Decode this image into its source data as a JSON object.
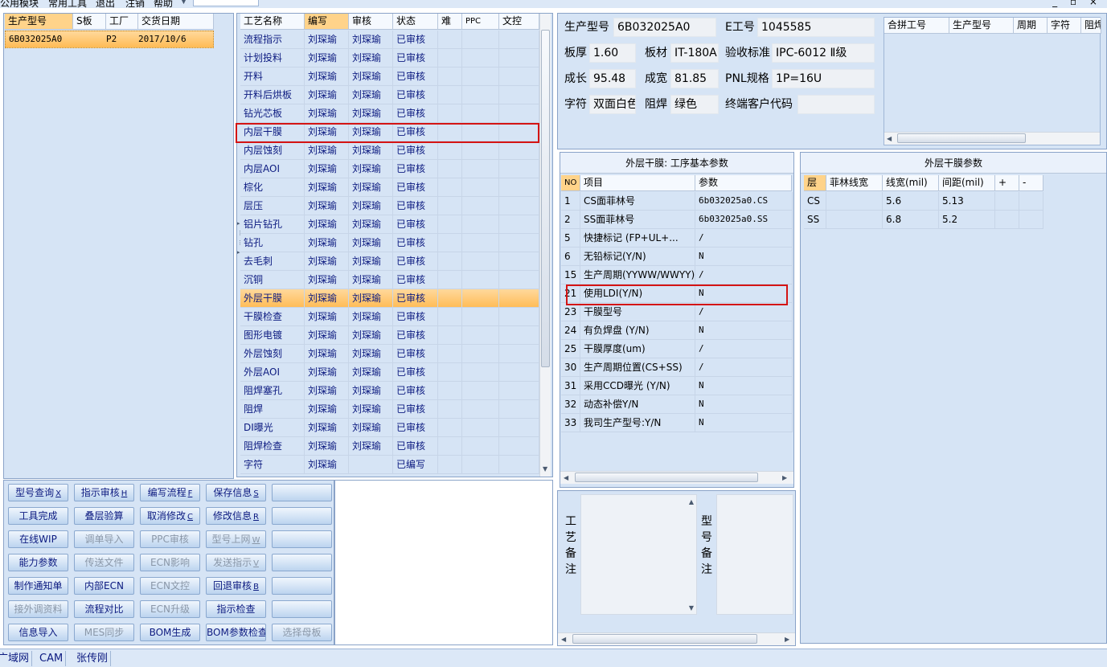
{
  "menu": {
    "items": [
      "公用模块",
      "常用工具",
      "退出",
      "注销",
      "帮助"
    ],
    "window_controls": "_ ▫ ×"
  },
  "order_list": {
    "headers": [
      "生产型号",
      "S板",
      "工厂",
      "交货日期"
    ],
    "rows": [
      {
        "model": "6B032025A0",
        "s_board": "",
        "factory": "P2",
        "delivery_date": "2017/10/6"
      }
    ]
  },
  "process_table": {
    "headers": [
      "工艺名称",
      "编写",
      "审核",
      "状态",
      "难",
      "PPC",
      "文控"
    ],
    "rows": [
      {
        "name": "流程指示",
        "writer": "刘琛瑜",
        "reviewer": "刘琛瑜",
        "status": "已审核"
      },
      {
        "name": "计划投料",
        "writer": "刘琛瑜",
        "reviewer": "刘琛瑜",
        "status": "已审核"
      },
      {
        "name": "开料",
        "writer": "刘琛瑜",
        "reviewer": "刘琛瑜",
        "status": "已审核"
      },
      {
        "name": "开料后烘板",
        "writer": "刘琛瑜",
        "reviewer": "刘琛瑜",
        "status": "已审核"
      },
      {
        "name": "钻光芯板",
        "writer": "刘琛瑜",
        "reviewer": "刘琛瑜",
        "status": "已审核"
      },
      {
        "name": "内层干膜",
        "writer": "刘琛瑜",
        "reviewer": "刘琛瑜",
        "status": "已审核"
      },
      {
        "name": "内层蚀刻",
        "writer": "刘琛瑜",
        "reviewer": "刘琛瑜",
        "status": "已审核"
      },
      {
        "name": "内层AOI",
        "writer": "刘琛瑜",
        "reviewer": "刘琛瑜",
        "status": "已审核"
      },
      {
        "name": "棕化",
        "writer": "刘琛瑜",
        "reviewer": "刘琛瑜",
        "status": "已审核"
      },
      {
        "name": "层压",
        "writer": "刘琛瑜",
        "reviewer": "刘琛瑜",
        "status": "已审核"
      },
      {
        "name": "铝片钻孔",
        "writer": "刘琛瑜",
        "reviewer": "刘琛瑜",
        "status": "已审核"
      },
      {
        "name": "钻孔",
        "writer": "刘琛瑜",
        "reviewer": "刘琛瑜",
        "status": "已审核"
      },
      {
        "name": "去毛刺",
        "writer": "刘琛瑜",
        "reviewer": "刘琛瑜",
        "status": "已审核"
      },
      {
        "name": "沉铜",
        "writer": "刘琛瑜",
        "reviewer": "刘琛瑜",
        "status": "已审核"
      },
      {
        "name": "外层干膜",
        "writer": "刘琛瑜",
        "reviewer": "刘琛瑜",
        "status": "已审核"
      },
      {
        "name": "干膜检查",
        "writer": "刘琛瑜",
        "reviewer": "刘琛瑜",
        "status": "已审核"
      },
      {
        "name": "图形电镀",
        "writer": "刘琛瑜",
        "reviewer": "刘琛瑜",
        "status": "已审核"
      },
      {
        "name": "外层蚀刻",
        "writer": "刘琛瑜",
        "reviewer": "刘琛瑜",
        "status": "已审核"
      },
      {
        "name": "外层AOI",
        "writer": "刘琛瑜",
        "reviewer": "刘琛瑜",
        "status": "已审核"
      },
      {
        "name": "阻焊塞孔",
        "writer": "刘琛瑜",
        "reviewer": "刘琛瑜",
        "status": "已审核"
      },
      {
        "name": "阻焊",
        "writer": "刘琛瑜",
        "reviewer": "刘琛瑜",
        "status": "已审核"
      },
      {
        "name": "DI曝光",
        "writer": "刘琛瑜",
        "reviewer": "刘琛瑜",
        "status": "已审核"
      },
      {
        "name": "阻焊检查",
        "writer": "刘琛瑜",
        "reviewer": "刘琛瑜",
        "status": "已审核"
      },
      {
        "name": "字符",
        "writer": "刘琛瑜",
        "reviewer": "",
        "status": "已编写"
      }
    ],
    "selected_index": 14,
    "highlighted_index": 5
  },
  "buttons": [
    {
      "label": "型号查询",
      "key": "X",
      "enabled": true
    },
    {
      "label": "指示审核",
      "key": "H",
      "enabled": true
    },
    {
      "label": "编写流程",
      "key": "F",
      "enabled": true
    },
    {
      "label": "保存信息",
      "key": "S",
      "enabled": true
    },
    {
      "label": "",
      "key": "",
      "enabled": true
    },
    {
      "label": "工具完成",
      "key": "",
      "enabled": true
    },
    {
      "label": "叠层验算",
      "key": "",
      "enabled": true
    },
    {
      "label": "取消修改",
      "key": "C",
      "enabled": true
    },
    {
      "label": "修改信息",
      "key": "R",
      "enabled": true
    },
    {
      "label": "",
      "key": "",
      "enabled": true
    },
    {
      "label": "在线WIP",
      "key": "",
      "enabled": true
    },
    {
      "label": "调单导入",
      "key": "",
      "enabled": false
    },
    {
      "label": "PPC审核",
      "key": "",
      "enabled": false
    },
    {
      "label": "型号上网",
      "key": "W",
      "enabled": false
    },
    {
      "label": "",
      "key": "",
      "enabled": true
    },
    {
      "label": "能力参数",
      "key": "",
      "enabled": true
    },
    {
      "label": "传送文件",
      "key": "",
      "enabled": false
    },
    {
      "label": "ECN影响",
      "key": "",
      "enabled": false
    },
    {
      "label": "发送指示",
      "key": "V",
      "enabled": false
    },
    {
      "label": "",
      "key": "",
      "enabled": true
    },
    {
      "label": "制作通知单",
      "key": "",
      "enabled": true
    },
    {
      "label": "内部ECN",
      "key": "",
      "enabled": true
    },
    {
      "label": "ECN文控",
      "key": "",
      "enabled": false
    },
    {
      "label": "回退审核",
      "key": "B",
      "enabled": true
    },
    {
      "label": "",
      "key": "",
      "enabled": true
    },
    {
      "label": "接外调资料",
      "key": "",
      "enabled": false
    },
    {
      "label": "流程对比",
      "key": "",
      "enabled": true
    },
    {
      "label": "ECN升级",
      "key": "",
      "enabled": false
    },
    {
      "label": "指示检查",
      "key": "",
      "enabled": true
    },
    {
      "label": "",
      "key": "",
      "enabled": true
    },
    {
      "label": "信息导入",
      "key": "",
      "enabled": true
    },
    {
      "label": "MES同步",
      "key": "",
      "enabled": false
    },
    {
      "label": "BOM生成",
      "key": "",
      "enabled": true
    },
    {
      "label": "BOM参数检查",
      "key": "",
      "enabled": true
    },
    {
      "label": "选择母板",
      "key": "",
      "enabled": false
    }
  ],
  "info": {
    "model_label": "生产型号",
    "model_value": "6B032025A0",
    "eno_label": "E工号",
    "eno_value": "1045585",
    "thickness_label": "板厚",
    "thickness_value": "1.60",
    "material_label": "板材",
    "material_value": "IT-180A",
    "standard_label": "验收标准",
    "standard_value": "IPC-6012 Ⅱ级",
    "length_label": "成长",
    "length_value": "95.48",
    "width_label": "成宽",
    "width_value": "81.85",
    "pnl_label": "PNL规格",
    "pnl_value": "1P=16U",
    "char_label": "字符",
    "char_value": "双面白色",
    "mask_label": "阻焊",
    "mask_value": "绿色",
    "customer_label": "终端客户代码",
    "customer_value": ""
  },
  "merge_table": {
    "headers": [
      "合拼工号",
      "生产型号",
      "周期",
      "字符",
      "阻焊"
    ]
  },
  "base_params": {
    "title": "外层干膜: 工序基本参数",
    "headers": [
      "NO",
      "项目",
      "参数"
    ],
    "rows": [
      {
        "no": "1",
        "item": "CS面菲林号",
        "value": "6b032025a0.CS"
      },
      {
        "no": "2",
        "item": "SS面菲林号",
        "value": "6b032025a0.SS"
      },
      {
        "no": "5",
        "item": "快捷标记 (FP+UL+...",
        "value": "/"
      },
      {
        "no": "6",
        "item": "无铅标记(Y/N)",
        "value": "N"
      },
      {
        "no": "15",
        "item": "生产周期(YYWW/WWYY)",
        "value": "/"
      },
      {
        "no": "21",
        "item": "使用LDI(Y/N)",
        "value": "N"
      },
      {
        "no": "23",
        "item": "干膜型号",
        "value": "/"
      },
      {
        "no": "24",
        "item": "有负焊盘 (Y/N)",
        "value": "N"
      },
      {
        "no": "25",
        "item": "干膜厚度(um)",
        "value": "/"
      },
      {
        "no": "30",
        "item": "生产周期位置(CS+SS)",
        "value": "/"
      },
      {
        "no": "31",
        "item": "采用CCD曝光 (Y/N)",
        "value": "N"
      },
      {
        "no": "32",
        "item": "动态补偿Y/N",
        "value": "N"
      },
      {
        "no": "33",
        "item": "我司生产型号:Y/N",
        "value": "N"
      }
    ]
  },
  "film_params": {
    "title": "外层干膜参数",
    "headers": [
      "层",
      "菲林线宽",
      "线宽(mil)",
      "间距(mil)",
      "+",
      "-"
    ],
    "rows": [
      {
        "layer": "CS",
        "film": "",
        "line_width": "5.6",
        "spacing": "5.13"
      },
      {
        "layer": "SS",
        "film": "",
        "line_width": "6.8",
        "spacing": "5.2"
      }
    ]
  },
  "notes": {
    "process_note_label": "工艺备注",
    "model_note_label": "型号备注"
  },
  "status_bar": [
    "广域网",
    "CAM",
    "张传刚"
  ]
}
